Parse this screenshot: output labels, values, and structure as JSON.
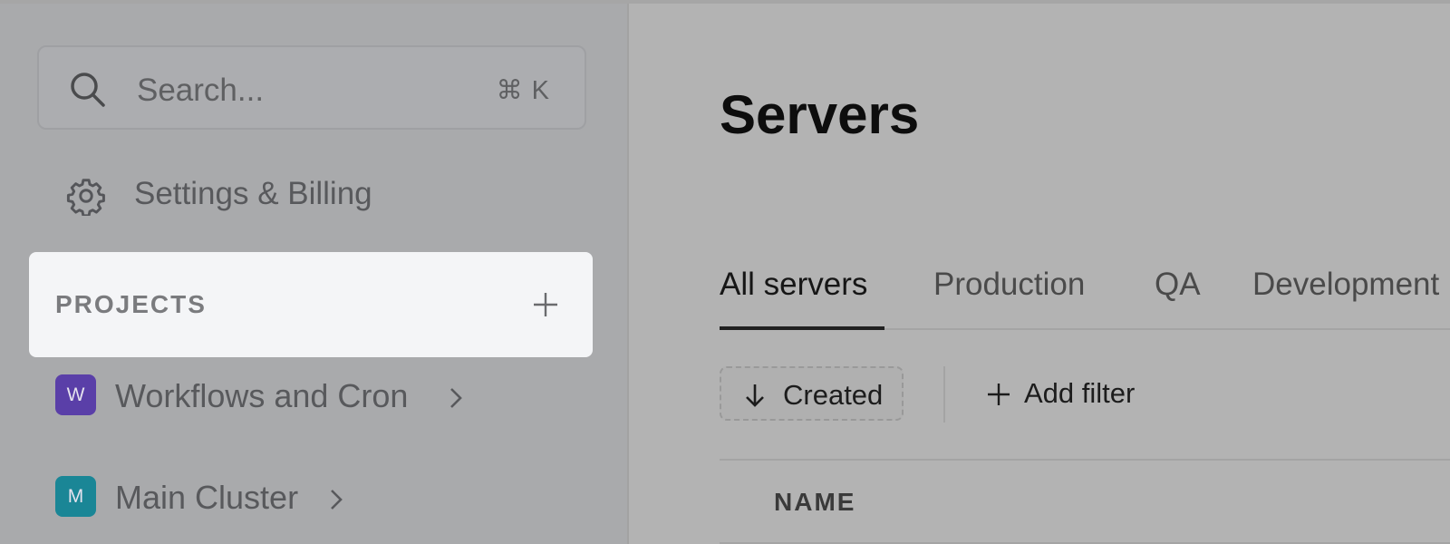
{
  "sidebar": {
    "search": {
      "placeholder": "Search...",
      "shortcut": "⌘ K"
    },
    "settings": {
      "label": "Settings & Billing"
    },
    "projects": {
      "header": "PROJECTS",
      "items": [
        {
          "initial": "W",
          "name": "Workflows and Cron",
          "color": "#5a3fa8"
        },
        {
          "initial": "M",
          "name": "Main Cluster",
          "color": "#1a8696"
        }
      ]
    }
  },
  "main": {
    "title": "Servers",
    "tabs": [
      {
        "label": "All servers",
        "active": true
      },
      {
        "label": "Production",
        "active": false
      },
      {
        "label": "QA",
        "active": false
      },
      {
        "label": "Development",
        "active": false
      }
    ],
    "sort_button": {
      "label": "Created",
      "icon": "arrow-down-icon"
    },
    "add_filter": {
      "label": "Add filter",
      "icon": "plus-icon"
    },
    "table": {
      "columns": [
        "NAME"
      ]
    }
  }
}
